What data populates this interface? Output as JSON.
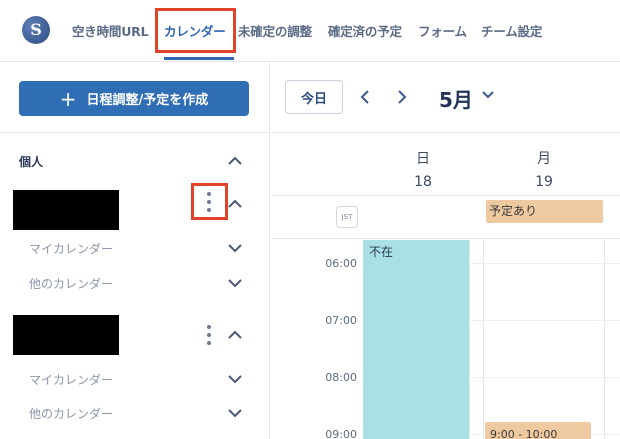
{
  "header": {
    "logo_letter": "S",
    "tabs": [
      {
        "label": "空き時間URL"
      },
      {
        "label": "カレンダー"
      },
      {
        "label": "未確定の調整"
      },
      {
        "label": "確定済の予定"
      },
      {
        "label": "フォーム"
      },
      {
        "label": "チーム設定"
      }
    ],
    "active_tab": "カレンダー"
  },
  "sidebar": {
    "create_button": {
      "label": "日程調整/予定を作成",
      "icon": "plus-icon"
    },
    "section_title": "個人",
    "accounts": [
      {
        "calendars": [
          {
            "label": "マイカレンダー"
          },
          {
            "label": "他のカレンダー"
          }
        ]
      },
      {
        "calendars": [
          {
            "label": "マイカレンダー"
          },
          {
            "label": "他のカレンダー"
          }
        ]
      }
    ]
  },
  "calendar": {
    "today_label": "今日",
    "month_label": "5月",
    "days": [
      {
        "name": "日",
        "num": "18"
      },
      {
        "name": "月",
        "num": "19"
      }
    ],
    "timezone": "JST",
    "all_day_event": "予定あり",
    "times": [
      "06:00",
      "07:00",
      "08:00",
      "09:00"
    ],
    "events": [
      {
        "label": "不在"
      },
      {
        "label": "9:00 - 10:00"
      }
    ]
  },
  "colors": {
    "accent": "#2f6db5",
    "highlight": "#e0442a",
    "absent_event": "#a9e0e6",
    "busy_event": "#efc99f"
  }
}
